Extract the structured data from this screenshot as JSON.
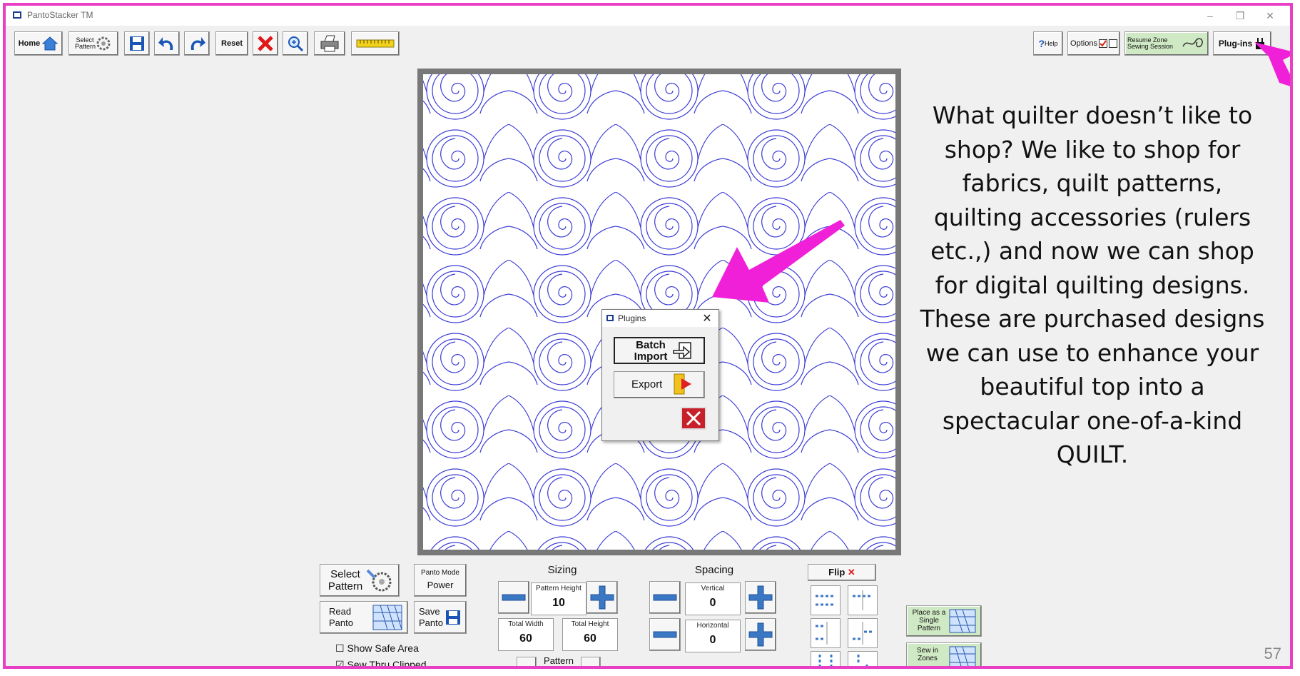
{
  "window": {
    "title": "PantoStacker TM"
  },
  "toolbar": {
    "home_label": "Home",
    "select_pattern_label": "Select Pattern",
    "reset_label": "Reset",
    "help_label": "Help",
    "options_label": "Options",
    "resume_zone_label": "Resume Zone Sewing Session",
    "plugins_label": "Plug-ins"
  },
  "description": {
    "text": "What quilter doesn’t like to shop?  We like to shop for fabrics, quilt patterns, quilting accessories (rulers etc.,) and now  we can shop for digital quilting designs.   These are purchased designs we can use to enhance your beautiful top into a spectacular one-of-a-kind QUILT."
  },
  "dialog": {
    "title": "Plugins",
    "batch_import_label": "Batch Import",
    "export_label": "Export"
  },
  "controls": {
    "select_pattern_label": "Select Pattern",
    "panto_mode_label": "Panto Mode",
    "power_label": "Power",
    "read_panto_label": "Read Panto",
    "save_panto_label": "Save Panto",
    "show_safe_area_label": "Show Safe Area",
    "sew_thru_clipped_label": "Sew Thru Clipped",
    "sizing_label": "Sizing",
    "pattern_height_label": "Pattern Height",
    "pattern_height_value": "10",
    "total_width_label": "Total Width",
    "total_width_value": "60",
    "total_height_label": "Total Height",
    "total_height_value": "60",
    "pattern_fitting_label": "Pattern Fitting",
    "spacing_label": "Spacing",
    "vertical_label": "Vertical",
    "vertical_value": "0",
    "horizontal_label": "Horizontal",
    "horizontal_value": "0",
    "flip_label": "Flip",
    "place_single_label": "Place as a Single Pattern",
    "sew_in_zones_label": "Sew in Zones"
  },
  "slide": {
    "page_number": "57"
  },
  "colors": {
    "frame": "#e83fc4",
    "pattern_line": "#3b3bd6",
    "arrow": "#f020d8"
  }
}
